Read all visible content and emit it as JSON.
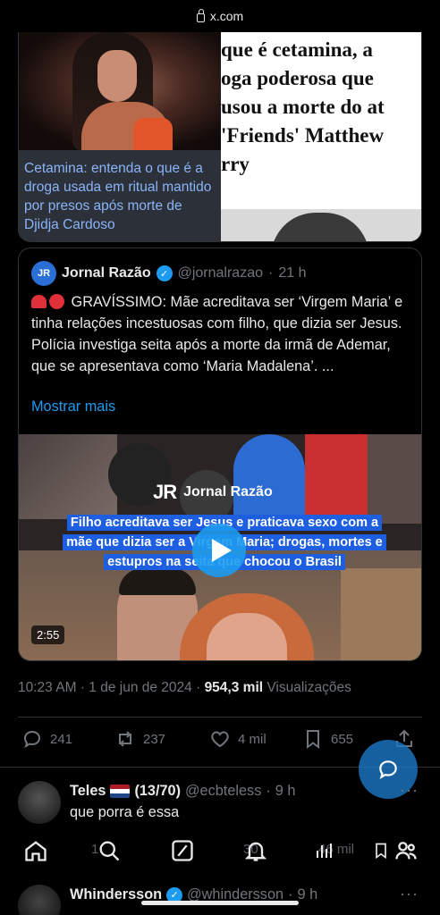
{
  "browser": {
    "url": "x.com"
  },
  "news_card": {
    "caption": "Cetamina: entenda o que é a droga usada em ritual mantido por presos após morte de Djidja Cardoso",
    "headline": "que é cetamina, a\noga poderosa que\nusou a morte do at\n'Friends' Matthew\nrry"
  },
  "quote": {
    "name": "Jornal Razão",
    "avatar_text": "JR",
    "handle": "@jornalrazao",
    "time": "21 h",
    "text": "GRAVÍSSIMO: Mãe acreditava ser ‘Virgem Maria’ e tinha relações incestuosas com filho, que dizia ser Jesus. Polícia investiga seita após a morte da irmã de Ademar, que se apresentava como ‘Maria Madalena’. ...",
    "show_more": "Mostrar mais",
    "video": {
      "brand": "Jornal Razão",
      "brand_logo": "JR",
      "overlay": "Filho acreditava ser Jesus e praticava sexo com a mãe que dizia ser a Virgem Maria; drogas, mortes e estupros na seita que chocou o Brasil",
      "duration": "2:55"
    }
  },
  "meta": {
    "time": "10:23 AM",
    "date": "1 de jun de 2024",
    "views_count": "954,3 mil",
    "views_label": "Visualizações"
  },
  "actions": {
    "replies": "241",
    "reposts": "237",
    "likes": "4 mil",
    "bookmarks": "655"
  },
  "replies": [
    {
      "name": "Teles",
      "badge": "(13/70)",
      "handle": "@ecbteless",
      "time": "9 h",
      "text": "que porra é essa"
    },
    {
      "name": "Whindersson",
      "handle": "@whindersson",
      "time": "9 h"
    }
  ],
  "ghost_stats": {
    "replies": "1",
    "likes": "30",
    "views": "46 mil"
  },
  "colors": {
    "accent": "#1d9bf0",
    "background": "#000000",
    "muted": "#71767b",
    "border": "#2f3336"
  }
}
